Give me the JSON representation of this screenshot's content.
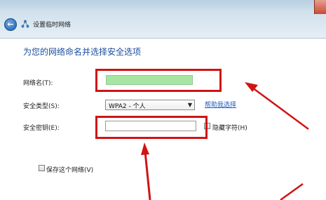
{
  "window": {
    "title": "设置临时网络",
    "back_icon": "back-arrow-icon",
    "network_icon": "network-icon"
  },
  "page": {
    "heading": "为您的网络命名并选择安全选项"
  },
  "form": {
    "network_name_label": "网络名(T):",
    "network_name_value": "",
    "security_type_label": "安全类型(S):",
    "security_type_value": "WPA2 - 个人",
    "help_link": "帮助我选择",
    "security_key_label": "安全密钥(E):",
    "security_key_value": "",
    "hide_chars_label": "隐藏字符(H)",
    "save_network_label": "保存这个网络(V)"
  },
  "colors": {
    "annotation_red": "#d01414",
    "heading_blue": "#1a4d9c",
    "ssid_highlight": "#a6e6a2"
  }
}
